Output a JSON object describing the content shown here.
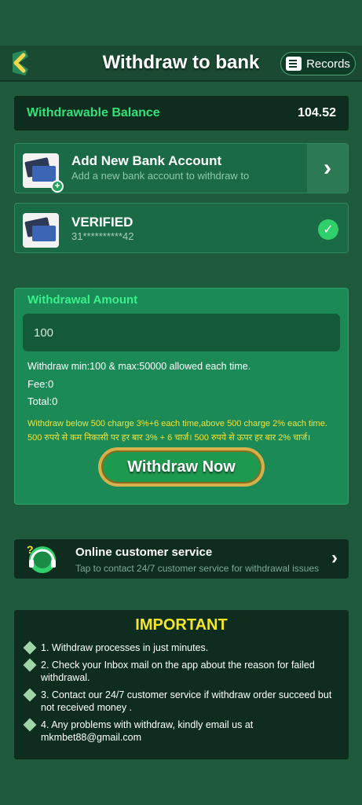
{
  "header": {
    "title": "Withdraw to bank",
    "records_label": "Records"
  },
  "balance": {
    "label": "Withdrawable Balance",
    "value": "104.52"
  },
  "add_bank": {
    "title": "Add New Bank Account",
    "subtitle": "Add a new bank account to withdraw to"
  },
  "verified_bank": {
    "status": "VERIFIED",
    "account": "31**********42"
  },
  "withdraw": {
    "heading": "Withdrawal Amount",
    "amount_value": "100",
    "rule": "Withdraw min:100 & max:50000 allowed each time.",
    "fee": "Fee:0",
    "total": "Total:0",
    "warning_en": "Withdraw below 500 charge 3%+6 each time,above 500 charge 2% each time.",
    "warning_hi": "500 रुपये से कम निकासी पर हर बार 3% + 6 चार्ज। 500 रुपये से ऊपर हर बार 2% चार्ज।",
    "button_label": "Withdraw Now"
  },
  "customer_service": {
    "title": "Online customer service",
    "subtitle": "Tap to contact 24/7 customer service for withdrawal issues"
  },
  "important": {
    "heading": "IMPORTANT",
    "items": [
      "1. Withdraw processes in just minutes.",
      "2. Check your Inbox mail on the app about the reason for failed withdrawal.",
      "3. Contact our 24/7 customer service if withdraw order succeed but not received money .",
      "4. Any problems with withdraw, kindly email us at mkmbet88@gmail.com"
    ]
  },
  "colors": {
    "background": "#1f5a3c",
    "accent_green": "#33e07a",
    "warning_yellow": "#f0e23a",
    "button_gold": "#d6b04a"
  }
}
